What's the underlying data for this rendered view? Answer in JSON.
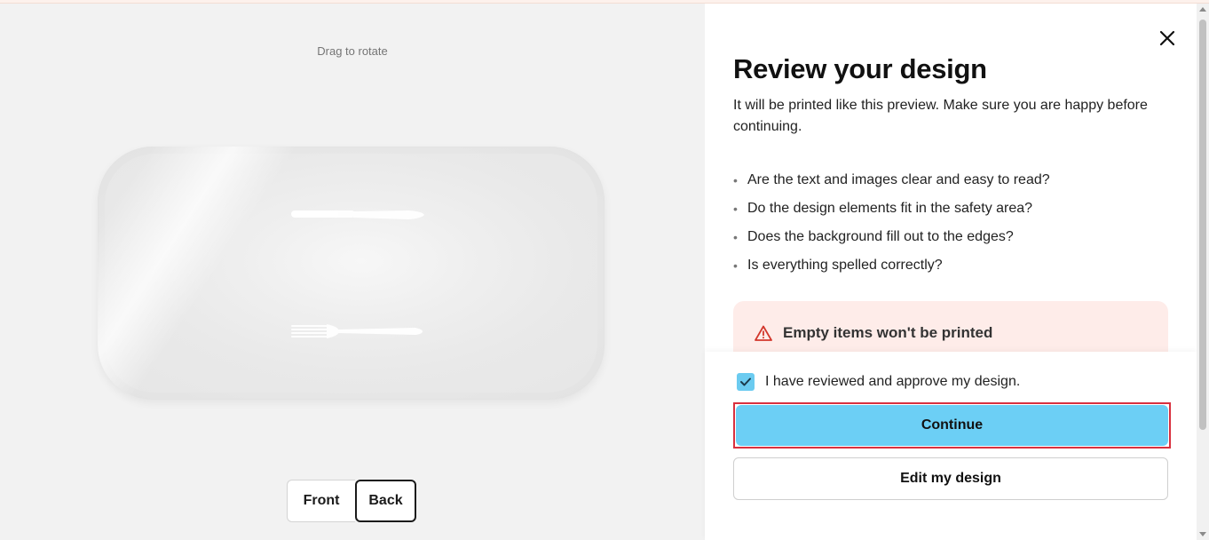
{
  "preview": {
    "hint": "Drag to rotate",
    "views": {
      "front_label": "Front",
      "back_label": "Back",
      "selected": "Back"
    }
  },
  "panel": {
    "title": "Review your design",
    "description": "It will be printed like this preview. Make sure you are happy before continuing.",
    "checklist": [
      "Are the text and images clear and easy to read?",
      "Do the design elements fit in the safety area?",
      "Does the background fill out to the edges?",
      "Is everything spelled correctly?"
    ],
    "warning": {
      "text": "Empty items won't be printed",
      "icon": "warning-triangle-icon"
    },
    "approve": {
      "label": "I have reviewed and approve my design.",
      "checked": true
    },
    "continue_label": "Continue",
    "edit_label": "Edit my design",
    "close_icon": "close-icon"
  },
  "colors": {
    "accent": "#6ccff5",
    "checkbox": "#6bcbf0",
    "warning_bg": "#feece9",
    "warning_icon": "#d2372c",
    "focus_outline": "#d9303e"
  }
}
